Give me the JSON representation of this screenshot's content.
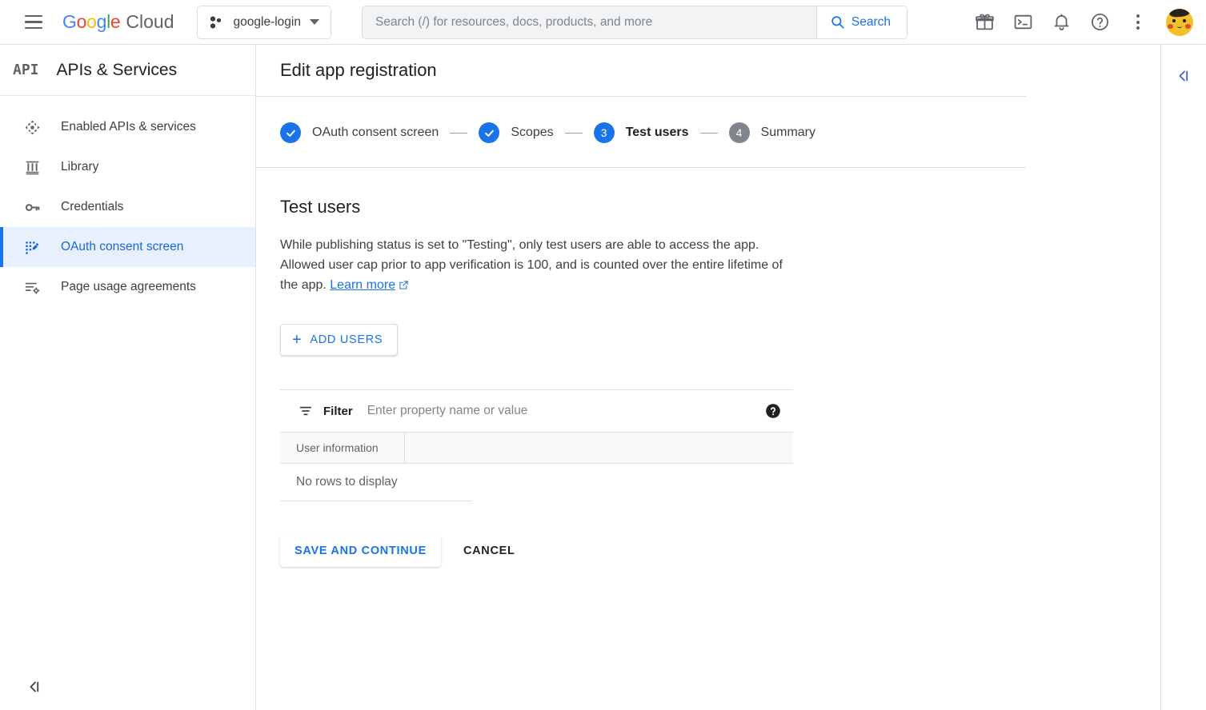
{
  "topbar": {
    "menu_icon": "hamburger-menu-icon",
    "brand": {
      "google": "Google",
      "cloud": "Cloud"
    },
    "project": {
      "name": "google-login",
      "icon": "project-dots-icon"
    },
    "search": {
      "placeholder": "Search (/) for resources, docs, products, and more",
      "value": "",
      "button_label": "Search",
      "icon": "search-icon"
    },
    "icons": [
      {
        "name": "gift-icon",
        "label": "Gifts / promotions"
      },
      {
        "name": "cloud-shell-icon",
        "label": "Activate Cloud Shell"
      },
      {
        "name": "bell-icon",
        "label": "Notifications"
      },
      {
        "name": "help-circle-icon",
        "label": "Help"
      },
      {
        "name": "kebab-menu-icon",
        "label": "More options"
      }
    ],
    "avatar": {
      "name": "user-avatar",
      "label": "Account"
    }
  },
  "sidebar": {
    "product_mark": "API",
    "title": "APIs & Services",
    "items": [
      {
        "label": "Enabled APIs & services",
        "icon": "dashboard-arrows-icon",
        "active": false
      },
      {
        "label": "Library",
        "icon": "library-pillars-icon",
        "active": false
      },
      {
        "label": "Credentials",
        "icon": "key-icon",
        "active": false
      },
      {
        "label": "OAuth consent screen",
        "icon": "consent-screen-icon",
        "active": true
      },
      {
        "label": "Page usage agreements",
        "icon": "page-agreements-icon",
        "active": false
      }
    ],
    "collapse_icon": "collapse-left-icon"
  },
  "main": {
    "page_title": "Edit app registration",
    "stepper": [
      {
        "number": "1",
        "label": "OAuth consent screen",
        "state": "done"
      },
      {
        "number": "2",
        "label": "Scopes",
        "state": "done"
      },
      {
        "number": "3",
        "label": "Test users",
        "state": "current"
      },
      {
        "number": "4",
        "label": "Summary",
        "state": "pending"
      }
    ],
    "section_title": "Test users",
    "description_part1": "While publishing status is set to \"Testing\", only test users are able to access the app. Allowed user cap prior to app verification is 100, and is counted over the entire lifetime of the app. ",
    "learn_more": "Learn more",
    "add_users_label": "ADD USERS",
    "filter": {
      "label": "Filter",
      "placeholder": "Enter property name or value",
      "value": "",
      "icon": "filter-icon",
      "help_icon": "help-filled-icon"
    },
    "table": {
      "columns": [
        "User information"
      ],
      "rows": [],
      "empty_message": "No rows to display"
    },
    "save_label": "SAVE AND CONTINUE",
    "cancel_label": "CANCEL"
  },
  "right_rail": {
    "collapse_icon": "collapse-right-panel-icon"
  },
  "colors": {
    "accent_blue": "#1a73e8",
    "active_bg": "#e8f0fe",
    "active_text": "#1967d2",
    "pending_gray": "#80868b",
    "text_primary": "#202124",
    "text_secondary": "#5f6368",
    "border": "#e0e0e0"
  }
}
